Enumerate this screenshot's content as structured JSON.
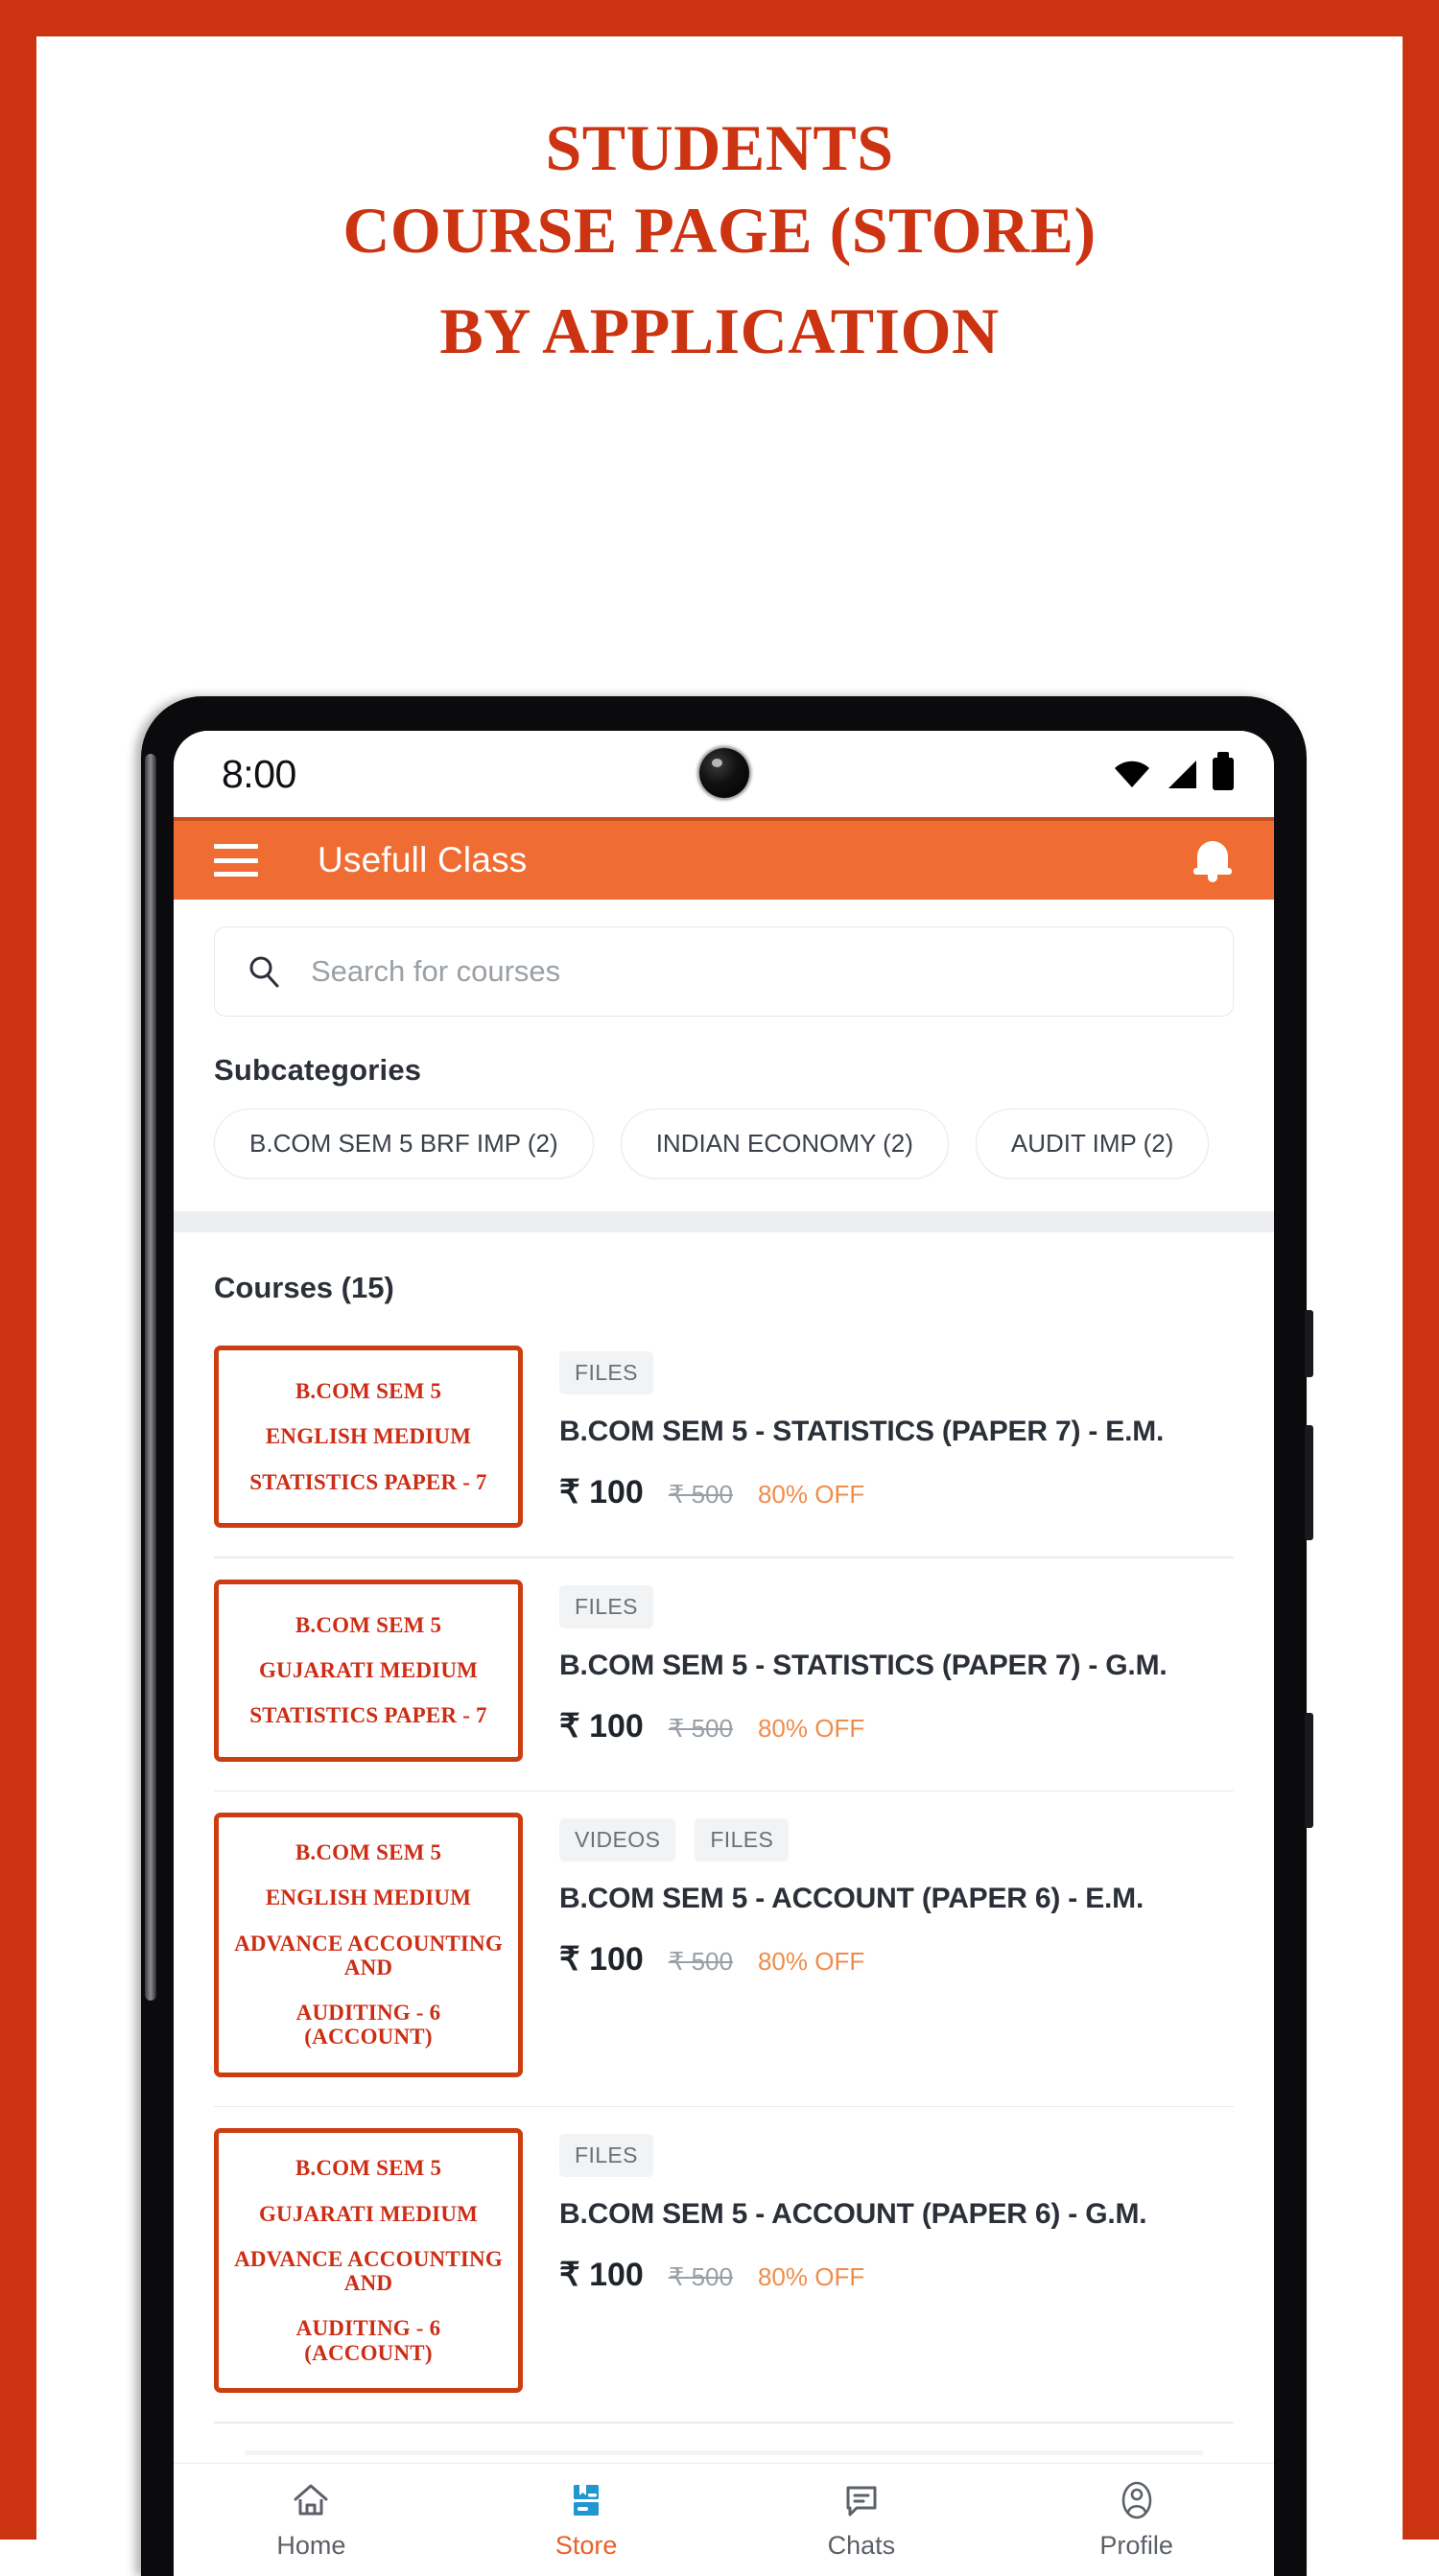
{
  "promo": {
    "line1": "STUDENTS",
    "line2": "COURSE PAGE (STORE)",
    "line3": "BY APPLICATION",
    "accent_color": "#cc3311"
  },
  "phone": {
    "status_bar": {
      "time": "8:00",
      "icons": [
        "wifi-icon",
        "cellular-signal-icon",
        "battery-icon"
      ]
    },
    "app_bar": {
      "menu_icon": "hamburger-menu-icon",
      "title": "Usefull Class",
      "notification_icon": "bell-icon",
      "background_color": "#ef6c33"
    },
    "search": {
      "icon": "search-icon",
      "placeholder": "Search for courses",
      "value": ""
    },
    "subcategories": {
      "label": "Subcategories",
      "chips": [
        {
          "label": "B.COM SEM 5 BRF IMP (2)"
        },
        {
          "label": "INDIAN ECONOMY (2)"
        },
        {
          "label": "AUDIT IMP (2)"
        }
      ]
    },
    "courses_header": "Courses (15)",
    "courses": [
      {
        "thumb_lines": [
          "B.COM SEM 5",
          "ENGLISH MEDIUM",
          "STATISTICS PAPER - 7"
        ],
        "badges": [
          "FILES"
        ],
        "title": "B.COM SEM 5 - STATISTICS (PAPER 7) - E.M.",
        "price": "₹ 100",
        "price_old": "₹ 500",
        "discount": "80% OFF"
      },
      {
        "thumb_lines": [
          "B.COM SEM 5",
          "GUJARATI MEDIUM",
          "STATISTICS PAPER - 7"
        ],
        "badges": [
          "FILES"
        ],
        "title": "B.COM SEM 5 - STATISTICS (PAPER 7) - G.M.",
        "price": "₹ 100",
        "price_old": "₹ 500",
        "discount": "80% OFF"
      },
      {
        "thumb_lines": [
          "B.COM SEM 5",
          "ENGLISH MEDIUM",
          "ADVANCE ACCOUNTING AND",
          "AUDITING - 6 (ACCOUNT)"
        ],
        "badges": [
          "VIDEOS",
          "FILES"
        ],
        "title": "B.COM SEM 5 - ACCOUNT (PAPER 6) - E.M.",
        "price": "₹ 100",
        "price_old": "₹ 500",
        "discount": "80% OFF"
      },
      {
        "thumb_lines": [
          "B.COM SEM 5",
          "GUJARATI MEDIUM",
          "ADVANCE ACCOUNTING AND",
          "AUDITING - 6 (ACCOUNT)"
        ],
        "badges": [
          "FILES"
        ],
        "title": "B.COM SEM 5 - ACCOUNT (PAPER 6) - G.M.",
        "price": "₹ 100",
        "price_old": "₹ 500",
        "discount": "80% OFF"
      }
    ],
    "bottom_nav": {
      "active": "Store",
      "items": [
        {
          "label": "Home",
          "icon": "home-icon"
        },
        {
          "label": "Store",
          "icon": "store-books-icon"
        },
        {
          "label": "Chats",
          "icon": "chat-bubble-icon"
        },
        {
          "label": "Profile",
          "icon": "person-icon"
        }
      ]
    }
  }
}
